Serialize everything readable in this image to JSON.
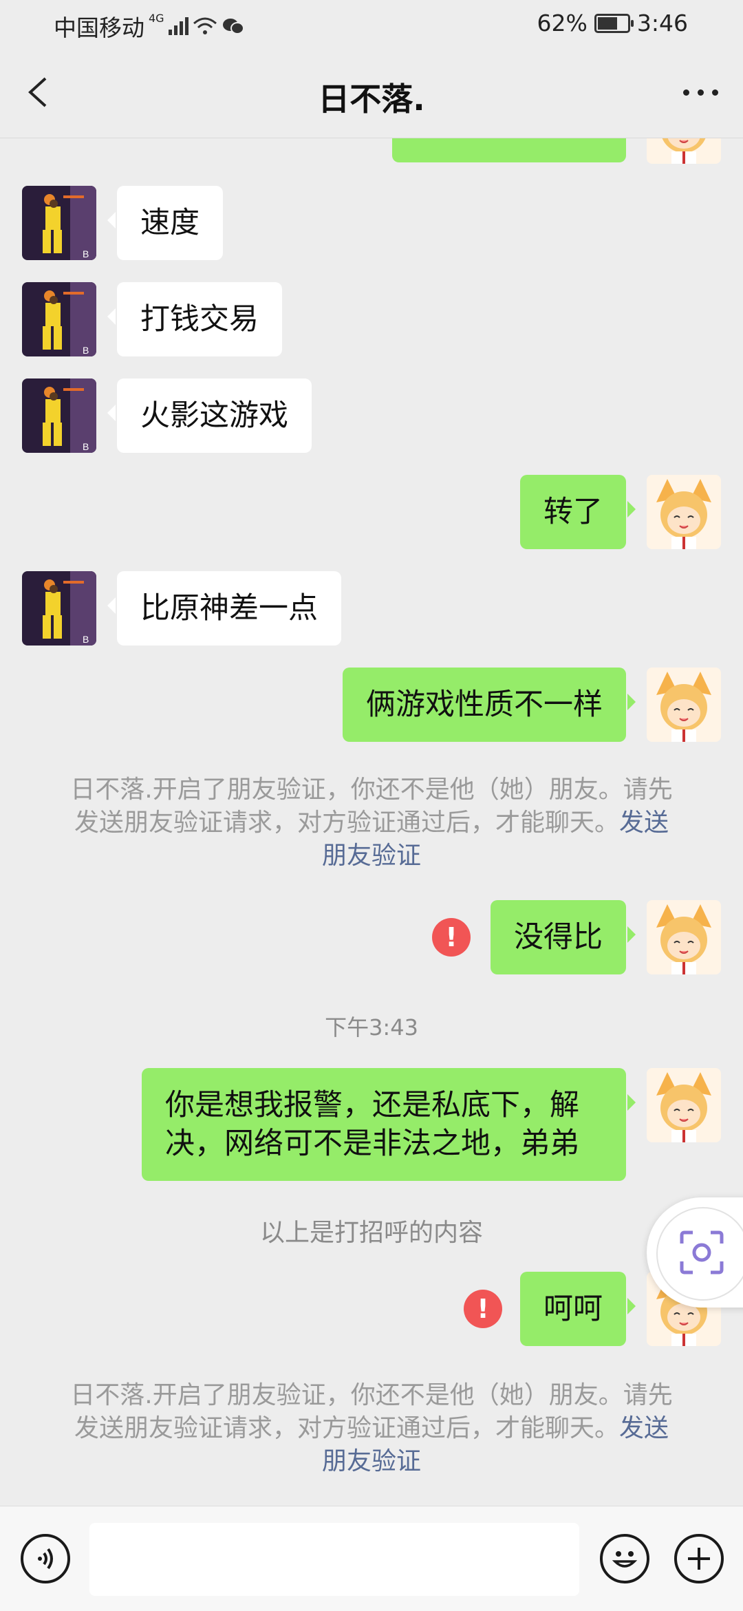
{
  "status_bar": {
    "carrier": "中国移动",
    "network": "4G",
    "battery": "62%",
    "time": "3:46"
  },
  "header": {
    "title": "日不落."
  },
  "messages": [
    {
      "dir": "in",
      "text": "速度"
    },
    {
      "dir": "in",
      "text": "打钱交易"
    },
    {
      "dir": "in",
      "text": "火影这游戏"
    },
    {
      "dir": "out",
      "text": "转了"
    },
    {
      "dir": "in",
      "text": "比原神差一点"
    },
    {
      "dir": "out",
      "text": "俩游戏性质不一样"
    },
    {
      "dir": "out",
      "text": "没得比"
    },
    {
      "dir": "out",
      "text": "你是想我报警，还是私底下，解决，网络可不是非法之地，弟弟"
    },
    {
      "dir": "out",
      "text": "呵呵"
    }
  ],
  "system": {
    "verify_notice": "日不落.开启了朋友验证，你还不是他（她）朋友。请先发送朋友验证请求，对方验证通过后，才能聊天。",
    "verify_link": "发送朋友验证",
    "timestamp": "下午3:43",
    "greeting_notice": "以上是打招呼的内容",
    "error_mark": "!"
  },
  "icons": {
    "back": "chevron-left-icon",
    "more": "more-icon",
    "voice": "voice-icon",
    "emoji": "emoji-icon",
    "plus": "plus-icon",
    "scan": "scan-icon"
  },
  "colors": {
    "outgoing_bubble": "#95ec69",
    "incoming_bubble": "#ffffff",
    "link": "#576b95",
    "error": "#f15555"
  }
}
